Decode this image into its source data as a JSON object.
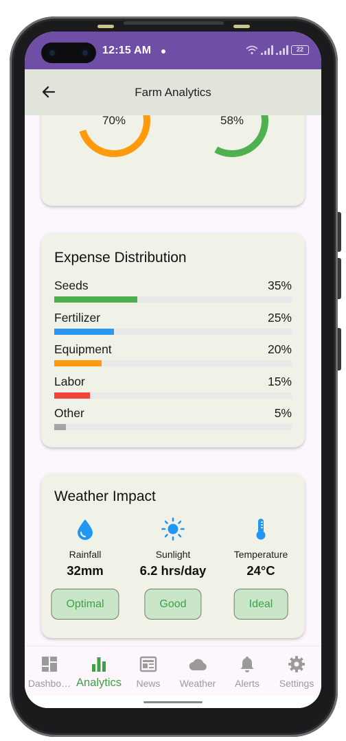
{
  "status_bar": {
    "time": "12:15 AM",
    "battery": "22"
  },
  "app_bar": {
    "title": "Farm Analytics",
    "back_icon": "arrow-left-icon"
  },
  "gauges": [
    {
      "value": "70%",
      "fraction": 0.7,
      "color": "#ff9a0d"
    },
    {
      "value": "58%",
      "fraction": 0.58,
      "color": "#4fb04f"
    }
  ],
  "expense": {
    "title": "Expense Distribution",
    "items": [
      {
        "label": "Seeds",
        "value": "35%",
        "fraction": 0.35,
        "color": "#4cae4f"
      },
      {
        "label": "Fertilizer",
        "value": "25%",
        "fraction": 0.25,
        "color": "#2b97f0"
      },
      {
        "label": "Equipment",
        "value": "20%",
        "fraction": 0.2,
        "color": "#fd9a0f"
      },
      {
        "label": "Labor",
        "value": "15%",
        "fraction": 0.15,
        "color": "#f1453a"
      },
      {
        "label": "Other",
        "value": "5%",
        "fraction": 0.05,
        "color": "#a5a5a5"
      }
    ]
  },
  "weather": {
    "title": "Weather Impact",
    "items": [
      {
        "icon": "water-drop-icon",
        "label": "Rainfall",
        "value": "32mm",
        "status": "Optimal",
        "color": "#2196f3"
      },
      {
        "icon": "sun-icon",
        "label": "Sunlight",
        "value": "6.2 hrs/day",
        "status": "Good",
        "color": "#2196f3"
      },
      {
        "icon": "thermometer-icon",
        "label": "Temperature",
        "value": "24°C",
        "status": "Ideal",
        "color": "#2196f3"
      }
    ]
  },
  "bottom_nav": {
    "items": [
      {
        "label": "Dashbo…",
        "icon": "dashboard-icon",
        "active": false
      },
      {
        "label": "Analytics",
        "icon": "bar-chart-icon",
        "active": true
      },
      {
        "label": "News",
        "icon": "newspaper-icon",
        "active": false
      },
      {
        "label": "Weather",
        "icon": "cloud-icon",
        "active": false
      },
      {
        "label": "Alerts",
        "icon": "bell-icon",
        "active": false
      },
      {
        "label": "Settings",
        "icon": "gear-icon",
        "active": false
      }
    ],
    "active_color": "#3fa044",
    "inactive_color": "#9a9a9a"
  }
}
